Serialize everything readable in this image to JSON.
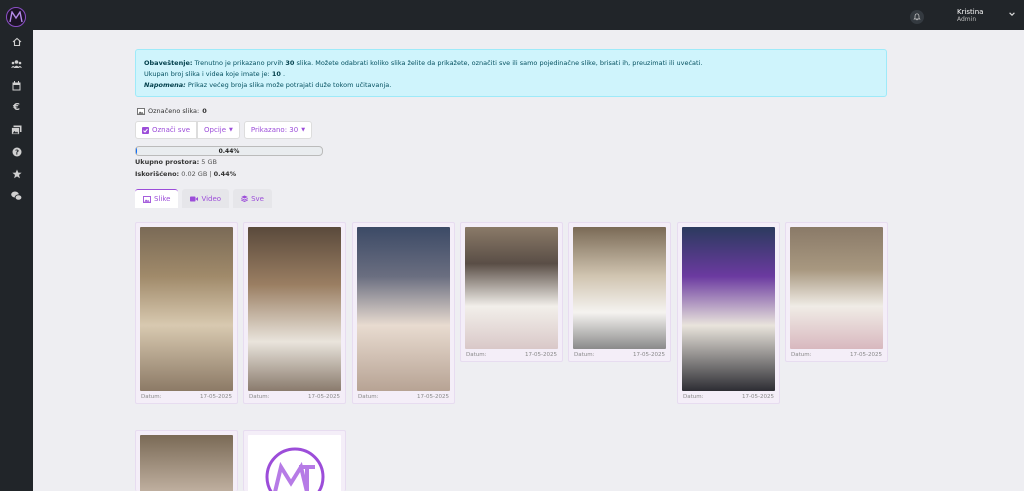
{
  "topbar": {
    "logo_text": "MJ",
    "user_name": "Kristina",
    "user_role": "Admin",
    "icons": [
      "bell-icon",
      "chevron-down-icon"
    ]
  },
  "sidebar": {
    "items": [
      "home-icon",
      "users-icon",
      "calendar-icon",
      "euro-icon",
      "images-icon",
      "question-icon",
      "star-icon",
      "chat-icon"
    ]
  },
  "alert": {
    "label1": "Obaveštenje:",
    "text1a": " Trenutno je prikazano prvih ",
    "count_shown": "30",
    "text1b": " slika. Možete odabrati koliko slika želite da prikažete, označiti sve ili samo pojedinačne slike, brisati ih, preuzimati ili uvećati.",
    "text2a": "Ukupan broj slika i videa koje imate je: ",
    "total": "10",
    "text2b": " .",
    "label3": "Napomena:",
    "text3": " Prikaz većeg broja slika može potrajati duže tokom učitavanja."
  },
  "selection": {
    "label": "Označeno slika:",
    "count": "0"
  },
  "toolbar": {
    "select_all": "Označi sve",
    "options": "Opcije",
    "shown": "Prikazano: 30"
  },
  "storage": {
    "percent_label": "0.44%",
    "percent_value": 0.44,
    "total_label": "Ukupno prostora:",
    "total_value": "5 GB",
    "used_label": "Iskorišćeno:",
    "used_value": "0.02 GB |",
    "used_percent": "0.44%"
  },
  "tabs": [
    {
      "label": "Slike",
      "icon": "image-icon",
      "active": true
    },
    {
      "label": "Video",
      "icon": "video-icon",
      "active": false
    },
    {
      "label": "Sve",
      "icon": "layers-icon",
      "active": false
    }
  ],
  "gallery": {
    "date_label": "Datum:",
    "date_value": "17-05-2025"
  },
  "colors": {
    "accent": "#9c4dd9",
    "alert_bg": "#cff4fc",
    "sidebar_bg": "#212529"
  }
}
